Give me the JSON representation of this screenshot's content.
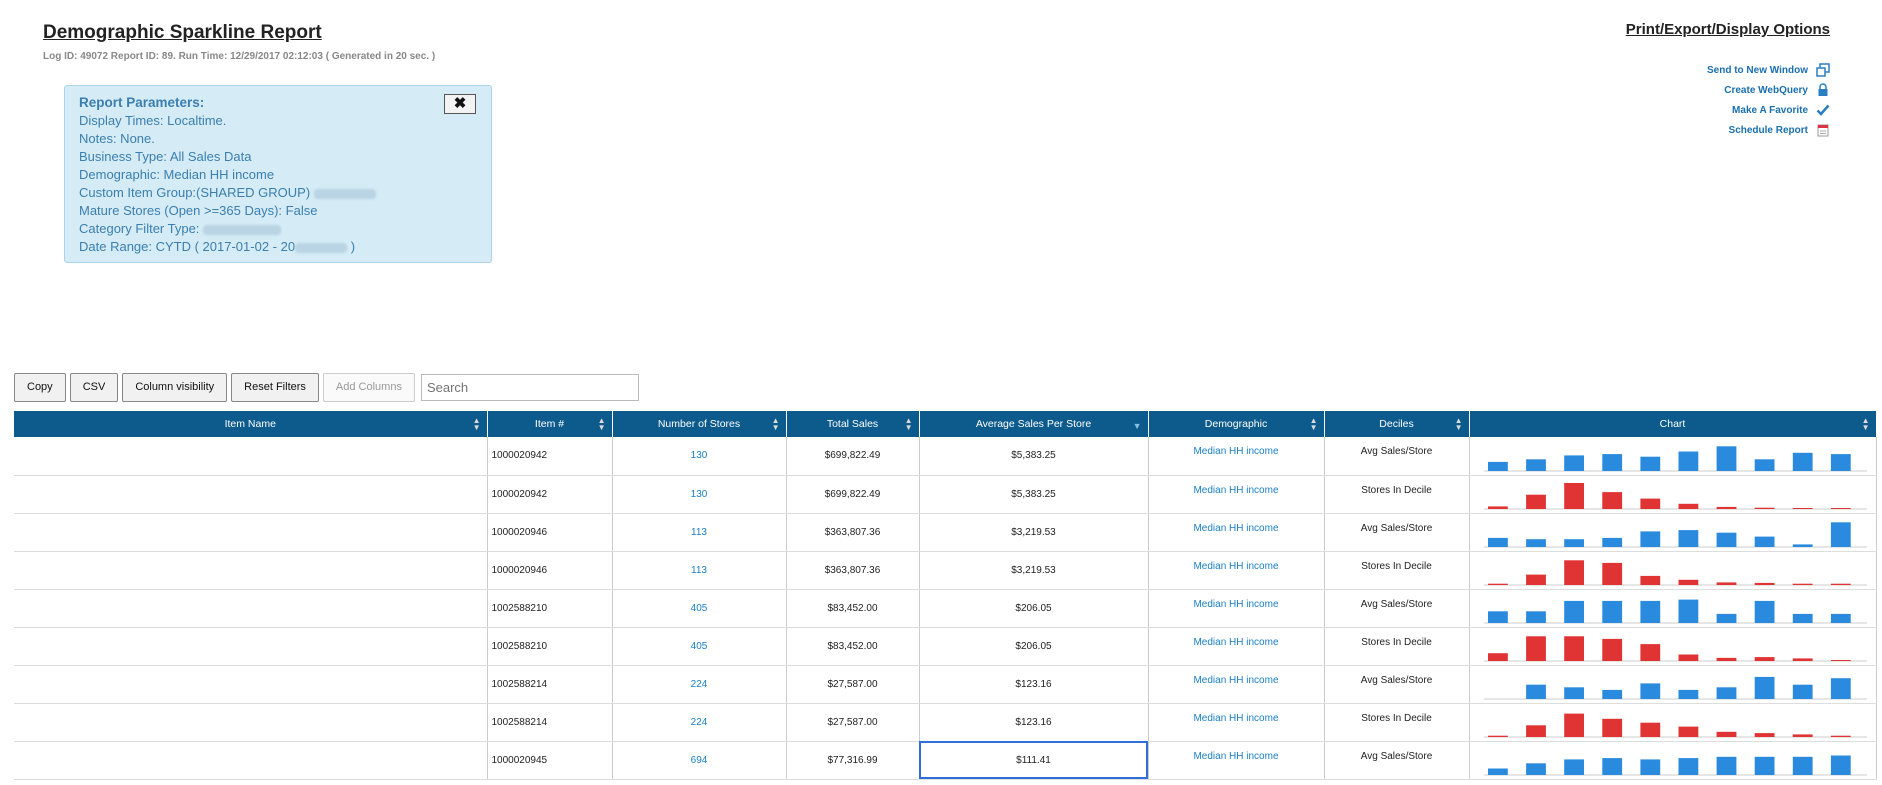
{
  "header": {
    "title": "Demographic Sparkline Report",
    "meta": "Log ID: 49072 Report ID: 89. Run Time: 12/29/2017 02:12:03 ( Generated in 20 sec. )"
  },
  "options": {
    "title": "Print/Export/Display Options",
    "items": [
      {
        "label": "Send to New Window",
        "icon": "new-window-icon"
      },
      {
        "label": "Create WebQuery",
        "icon": "lock-icon"
      },
      {
        "label": "Make A Favorite",
        "icon": "checkmark-icon"
      },
      {
        "label": "Schedule Report",
        "icon": "calendar-icon"
      }
    ]
  },
  "params": {
    "title": "Report Parameters:",
    "close": "✖",
    "lines": [
      "Display Times: Localtime.",
      "Notes: None.",
      "Business Type: All Sales Data",
      "Demographic: Median HH income",
      "Custom Item Group:(SHARED GROUP)",
      "Mature Stores (Open >=365 Days): False",
      "Category Filter Type:",
      "Date Range: CYTD ( 2017-01-02 - 20"
    ],
    "date_suffix": ")"
  },
  "toolbar": {
    "copy": "Copy",
    "csv": "CSV",
    "visibility": "Column visibility",
    "reset": "Reset Filters",
    "add_columns": "Add Columns",
    "search_placeholder": "Search"
  },
  "table": {
    "columns": [
      "Item Name",
      "Item #",
      "Number of Stores",
      "Total Sales",
      "Average Sales Per Store",
      "Demographic",
      "Deciles",
      "Chart"
    ],
    "rows": [
      {
        "item": "1000020942",
        "stores": "130",
        "total": "$699,822.49",
        "avg": "$5,383.25",
        "demo": "Median HH income",
        "decile": "Avg Sales/Store",
        "bars": [
          0.35,
          0.45,
          0.6,
          0.65,
          0.55,
          0.75,
          0.95,
          0.45,
          0.7,
          0.65
        ],
        "color": "#2a8bde"
      },
      {
        "item": "1000020942",
        "stores": "130",
        "total": "$699,822.49",
        "avg": "$5,383.25",
        "demo": "Median HH income",
        "decile": "Stores In Decile",
        "bars": [
          0.1,
          0.55,
          1.0,
          0.65,
          0.4,
          0.2,
          0.08,
          0.05,
          0.04,
          0.03
        ],
        "color": "#e03434"
      },
      {
        "item": "1000020946",
        "stores": "113",
        "total": "$363,807.36",
        "avg": "$3,219.53",
        "demo": "Median HH income",
        "decile": "Avg Sales/Store",
        "bars": [
          0.35,
          0.3,
          0.3,
          0.35,
          0.6,
          0.65,
          0.55,
          0.4,
          0.1,
          0.95
        ],
        "color": "#2a8bde"
      },
      {
        "item": "1000020946",
        "stores": "113",
        "total": "$363,807.36",
        "avg": "$3,219.53",
        "demo": "Median HH income",
        "decile": "Stores In Decile",
        "bars": [
          0.05,
          0.4,
          0.95,
          0.85,
          0.35,
          0.2,
          0.1,
          0.08,
          0.05,
          0.05
        ],
        "color": "#e03434"
      },
      {
        "item": "1002588210",
        "stores": "405",
        "total": "$83,452.00",
        "avg": "$206.05",
        "demo": "Median HH income",
        "decile": "Avg Sales/Store",
        "bars": [
          0.45,
          0.45,
          0.85,
          0.85,
          0.85,
          0.9,
          0.35,
          0.85,
          0.35,
          0.35
        ],
        "color": "#2a8bde"
      },
      {
        "item": "1002588210",
        "stores": "405",
        "total": "$83,452.00",
        "avg": "$206.05",
        "demo": "Median HH income",
        "decile": "Stores In Decile",
        "bars": [
          0.3,
          0.95,
          0.95,
          0.85,
          0.65,
          0.25,
          0.12,
          0.15,
          0.1,
          0.03
        ],
        "color": "#e03434"
      },
      {
        "item": "1002588214",
        "stores": "224",
        "total": "$27,587.00",
        "avg": "$123.16",
        "demo": "Median HH income",
        "decile": "Avg Sales/Store",
        "bars": [
          0.0,
          0.55,
          0.45,
          0.35,
          0.6,
          0.35,
          0.45,
          0.85,
          0.55,
          0.8
        ],
        "color": "#2a8bde"
      },
      {
        "item": "1002588214",
        "stores": "224",
        "total": "$27,587.00",
        "avg": "$123.16",
        "demo": "Median HH income",
        "decile": "Stores In Decile",
        "bars": [
          0.05,
          0.45,
          0.9,
          0.7,
          0.55,
          0.4,
          0.2,
          0.15,
          0.1,
          0.05
        ],
        "color": "#e03434"
      },
      {
        "item": "1000020945",
        "stores": "694",
        "total": "$77,316.99",
        "avg": "$111.41",
        "demo": "Median HH income",
        "decile": "Avg Sales/Store",
        "bars": [
          0.25,
          0.45,
          0.6,
          0.65,
          0.6,
          0.65,
          0.7,
          0.7,
          0.7,
          0.75
        ],
        "color": "#2a8bde"
      }
    ]
  }
}
